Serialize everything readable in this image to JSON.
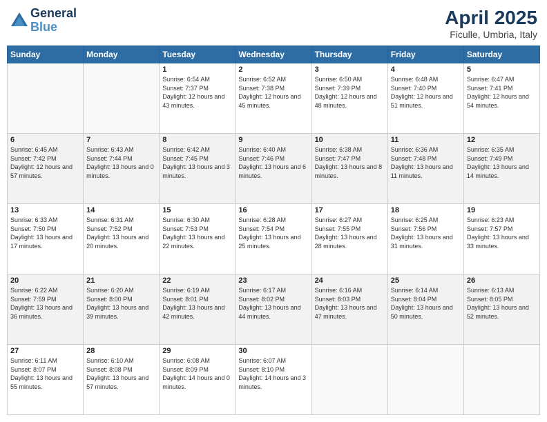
{
  "header": {
    "logo_line1": "General",
    "logo_line2": "Blue",
    "month": "April 2025",
    "location": "Ficulle, Umbria, Italy"
  },
  "days_of_week": [
    "Sunday",
    "Monday",
    "Tuesday",
    "Wednesday",
    "Thursday",
    "Friday",
    "Saturday"
  ],
  "weeks": [
    [
      {
        "day": "",
        "sunrise": "",
        "sunset": "",
        "daylight": ""
      },
      {
        "day": "",
        "sunrise": "",
        "sunset": "",
        "daylight": ""
      },
      {
        "day": "1",
        "sunrise": "Sunrise: 6:54 AM",
        "sunset": "Sunset: 7:37 PM",
        "daylight": "Daylight: 12 hours and 43 minutes."
      },
      {
        "day": "2",
        "sunrise": "Sunrise: 6:52 AM",
        "sunset": "Sunset: 7:38 PM",
        "daylight": "Daylight: 12 hours and 45 minutes."
      },
      {
        "day": "3",
        "sunrise": "Sunrise: 6:50 AM",
        "sunset": "Sunset: 7:39 PM",
        "daylight": "Daylight: 12 hours and 48 minutes."
      },
      {
        "day": "4",
        "sunrise": "Sunrise: 6:48 AM",
        "sunset": "Sunset: 7:40 PM",
        "daylight": "Daylight: 12 hours and 51 minutes."
      },
      {
        "day": "5",
        "sunrise": "Sunrise: 6:47 AM",
        "sunset": "Sunset: 7:41 PM",
        "daylight": "Daylight: 12 hours and 54 minutes."
      }
    ],
    [
      {
        "day": "6",
        "sunrise": "Sunrise: 6:45 AM",
        "sunset": "Sunset: 7:42 PM",
        "daylight": "Daylight: 12 hours and 57 minutes."
      },
      {
        "day": "7",
        "sunrise": "Sunrise: 6:43 AM",
        "sunset": "Sunset: 7:44 PM",
        "daylight": "Daylight: 13 hours and 0 minutes."
      },
      {
        "day": "8",
        "sunrise": "Sunrise: 6:42 AM",
        "sunset": "Sunset: 7:45 PM",
        "daylight": "Daylight: 13 hours and 3 minutes."
      },
      {
        "day": "9",
        "sunrise": "Sunrise: 6:40 AM",
        "sunset": "Sunset: 7:46 PM",
        "daylight": "Daylight: 13 hours and 6 minutes."
      },
      {
        "day": "10",
        "sunrise": "Sunrise: 6:38 AM",
        "sunset": "Sunset: 7:47 PM",
        "daylight": "Daylight: 13 hours and 8 minutes."
      },
      {
        "day": "11",
        "sunrise": "Sunrise: 6:36 AM",
        "sunset": "Sunset: 7:48 PM",
        "daylight": "Daylight: 13 hours and 11 minutes."
      },
      {
        "day": "12",
        "sunrise": "Sunrise: 6:35 AM",
        "sunset": "Sunset: 7:49 PM",
        "daylight": "Daylight: 13 hours and 14 minutes."
      }
    ],
    [
      {
        "day": "13",
        "sunrise": "Sunrise: 6:33 AM",
        "sunset": "Sunset: 7:50 PM",
        "daylight": "Daylight: 13 hours and 17 minutes."
      },
      {
        "day": "14",
        "sunrise": "Sunrise: 6:31 AM",
        "sunset": "Sunset: 7:52 PM",
        "daylight": "Daylight: 13 hours and 20 minutes."
      },
      {
        "day": "15",
        "sunrise": "Sunrise: 6:30 AM",
        "sunset": "Sunset: 7:53 PM",
        "daylight": "Daylight: 13 hours and 22 minutes."
      },
      {
        "day": "16",
        "sunrise": "Sunrise: 6:28 AM",
        "sunset": "Sunset: 7:54 PM",
        "daylight": "Daylight: 13 hours and 25 minutes."
      },
      {
        "day": "17",
        "sunrise": "Sunrise: 6:27 AM",
        "sunset": "Sunset: 7:55 PM",
        "daylight": "Daylight: 13 hours and 28 minutes."
      },
      {
        "day": "18",
        "sunrise": "Sunrise: 6:25 AM",
        "sunset": "Sunset: 7:56 PM",
        "daylight": "Daylight: 13 hours and 31 minutes."
      },
      {
        "day": "19",
        "sunrise": "Sunrise: 6:23 AM",
        "sunset": "Sunset: 7:57 PM",
        "daylight": "Daylight: 13 hours and 33 minutes."
      }
    ],
    [
      {
        "day": "20",
        "sunrise": "Sunrise: 6:22 AM",
        "sunset": "Sunset: 7:59 PM",
        "daylight": "Daylight: 13 hours and 36 minutes."
      },
      {
        "day": "21",
        "sunrise": "Sunrise: 6:20 AM",
        "sunset": "Sunset: 8:00 PM",
        "daylight": "Daylight: 13 hours and 39 minutes."
      },
      {
        "day": "22",
        "sunrise": "Sunrise: 6:19 AM",
        "sunset": "Sunset: 8:01 PM",
        "daylight": "Daylight: 13 hours and 42 minutes."
      },
      {
        "day": "23",
        "sunrise": "Sunrise: 6:17 AM",
        "sunset": "Sunset: 8:02 PM",
        "daylight": "Daylight: 13 hours and 44 minutes."
      },
      {
        "day": "24",
        "sunrise": "Sunrise: 6:16 AM",
        "sunset": "Sunset: 8:03 PM",
        "daylight": "Daylight: 13 hours and 47 minutes."
      },
      {
        "day": "25",
        "sunrise": "Sunrise: 6:14 AM",
        "sunset": "Sunset: 8:04 PM",
        "daylight": "Daylight: 13 hours and 50 minutes."
      },
      {
        "day": "26",
        "sunrise": "Sunrise: 6:13 AM",
        "sunset": "Sunset: 8:05 PM",
        "daylight": "Daylight: 13 hours and 52 minutes."
      }
    ],
    [
      {
        "day": "27",
        "sunrise": "Sunrise: 6:11 AM",
        "sunset": "Sunset: 8:07 PM",
        "daylight": "Daylight: 13 hours and 55 minutes."
      },
      {
        "day": "28",
        "sunrise": "Sunrise: 6:10 AM",
        "sunset": "Sunset: 8:08 PM",
        "daylight": "Daylight: 13 hours and 57 minutes."
      },
      {
        "day": "29",
        "sunrise": "Sunrise: 6:08 AM",
        "sunset": "Sunset: 8:09 PM",
        "daylight": "Daylight: 14 hours and 0 minutes."
      },
      {
        "day": "30",
        "sunrise": "Sunrise: 6:07 AM",
        "sunset": "Sunset: 8:10 PM",
        "daylight": "Daylight: 14 hours and 3 minutes."
      },
      {
        "day": "",
        "sunrise": "",
        "sunset": "",
        "daylight": ""
      },
      {
        "day": "",
        "sunrise": "",
        "sunset": "",
        "daylight": ""
      },
      {
        "day": "",
        "sunrise": "",
        "sunset": "",
        "daylight": ""
      }
    ]
  ]
}
